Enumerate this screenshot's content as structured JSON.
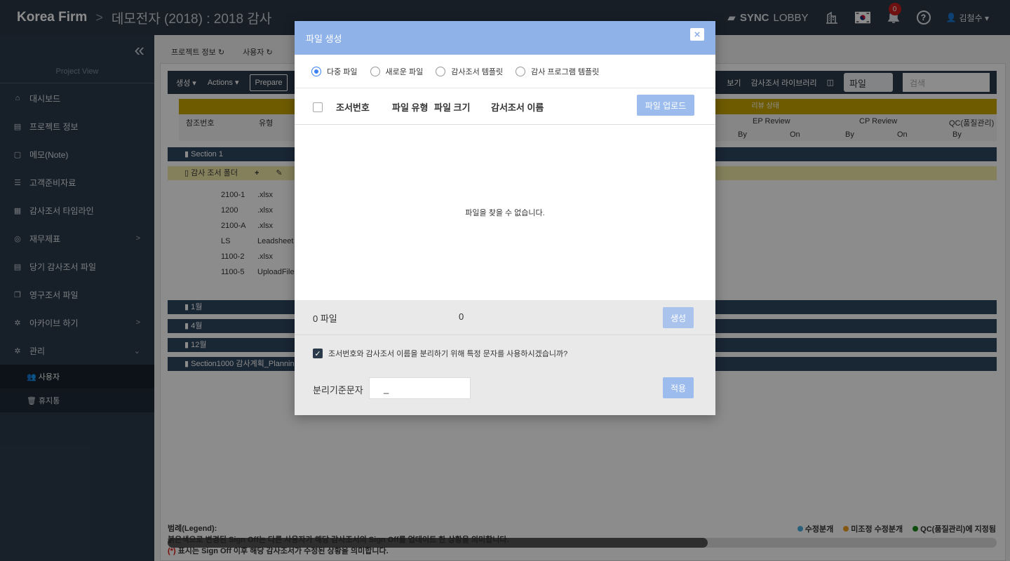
{
  "topbar": {
    "brand": "Korea Firm",
    "separator": ">",
    "project_title": "데모전자 (2018) : 2018 감사",
    "sync_prefix": "SYNC",
    "sync_suffix": "LOBBY",
    "notification_count": "0",
    "help": "?",
    "user_name": "김철수 ▾"
  },
  "sidebar": {
    "collapse_glyph": "«",
    "caption": "Project View",
    "items": [
      {
        "label": "대시보드",
        "icon": "home-icon",
        "glyph": "⌂"
      },
      {
        "label": "프로젝트 정보",
        "icon": "info-icon",
        "glyph": "▤"
      },
      {
        "label": "메모(Note)",
        "icon": "note-icon",
        "glyph": "▢"
      },
      {
        "label": "고객준비자료",
        "icon": "table-icon",
        "glyph": "☰"
      },
      {
        "label": "감사조서 타임라인",
        "icon": "calendar-icon",
        "glyph": "▦"
      },
      {
        "label": "재무제표",
        "icon": "coins-icon",
        "glyph": "◎",
        "chevron": ">"
      },
      {
        "label": "당기 감사조서 파일",
        "icon": "file-icon",
        "glyph": "▤"
      },
      {
        "label": "영구조서 파일",
        "icon": "clone-icon",
        "glyph": "❐"
      },
      {
        "label": "아카이브 하기",
        "icon": "gear-icon",
        "glyph": "✲",
        "chevron": ">"
      },
      {
        "label": "관리",
        "icon": "gear-icon",
        "glyph": "✲",
        "chevron": "⌄"
      }
    ],
    "sub_items": [
      {
        "label": "👥 사용자"
      },
      {
        "label": "🗑 휴지통"
      }
    ]
  },
  "main": {
    "tabs": [
      "프로젝트 정보 ↻",
      "사용자 ↻"
    ],
    "toolbar": {
      "create": "생성 ▾",
      "actions": "Actions ▾",
      "prepare": "Prepare",
      "preview": "보기",
      "library": "감사조서 라이브러리",
      "select_value": "파일",
      "search_placeholder": "검색"
    },
    "review_band": "리뷰 상태",
    "columns": {
      "ref": "참조번호",
      "type": "유형",
      "ep_review": "EP Review",
      "cp_review": "CP Review",
      "qc": "QC(품질관리)",
      "by": "By",
      "on": "On"
    },
    "sections": [
      "Section 1",
      "1월",
      "4월",
      "12월",
      "Section1000 감사계획_Planning"
    ],
    "folder": "감사 조서 폴더",
    "files": [
      {
        "code": "2100-1",
        "type": ".xlsx"
      },
      {
        "code": "1200",
        "type": ".xlsx"
      },
      {
        "code": "2100-A",
        "type": ".xlsx"
      },
      {
        "code": "LS",
        "type": "Leadsheet"
      },
      {
        "code": "1100-2",
        "type": ".xlsx"
      },
      {
        "code": "1100-5",
        "type": "UploadFile"
      }
    ],
    "legend": {
      "title": "범례(Legend):",
      "line1": "붉은색으로 변경된 Sign Off는 다른 사용자가 해당 감사조서의 Sign Off를 업데이트 한 상황을 의미합니다.",
      "line2_mark": "(*)",
      "line2": " 표시는 Sign Off 이후 해당 감사조서가 수정된 상황을 의미합니다.",
      "items": [
        {
          "label": "수정분개",
          "color": "#4fb0e0"
        },
        {
          "label": "미조정 수정분개",
          "color": "#f0a020"
        },
        {
          "label": "QC(품질관리)에 지정됨",
          "color": "#1a8a1a"
        }
      ]
    }
  },
  "modal": {
    "title": "파일 생성",
    "close": "×",
    "radios": [
      {
        "label": "다중 파일",
        "checked": true
      },
      {
        "label": "새로운 파일",
        "checked": false
      },
      {
        "label": "감사조서 템플릿",
        "checked": false
      },
      {
        "label": "감사 프로그램 템플릿",
        "checked": false
      }
    ],
    "headers": {
      "ref": "조서번호",
      "type": "파일 유형",
      "size": "파일 크기",
      "name": "감서조서 이름"
    },
    "upload_button": "파일 업로드",
    "empty_message": "파일을 찾을 수 없습니다.",
    "file_count": "0 파일",
    "total_size": "0",
    "create_button": "생성",
    "separator_question": "조서번호와 감사조서 이름을 분리하기 위해 특정 문자를 사용하시겠습니까?",
    "separator_label": "분리기준문자",
    "separator_value": "_",
    "apply_button": "적용"
  }
}
